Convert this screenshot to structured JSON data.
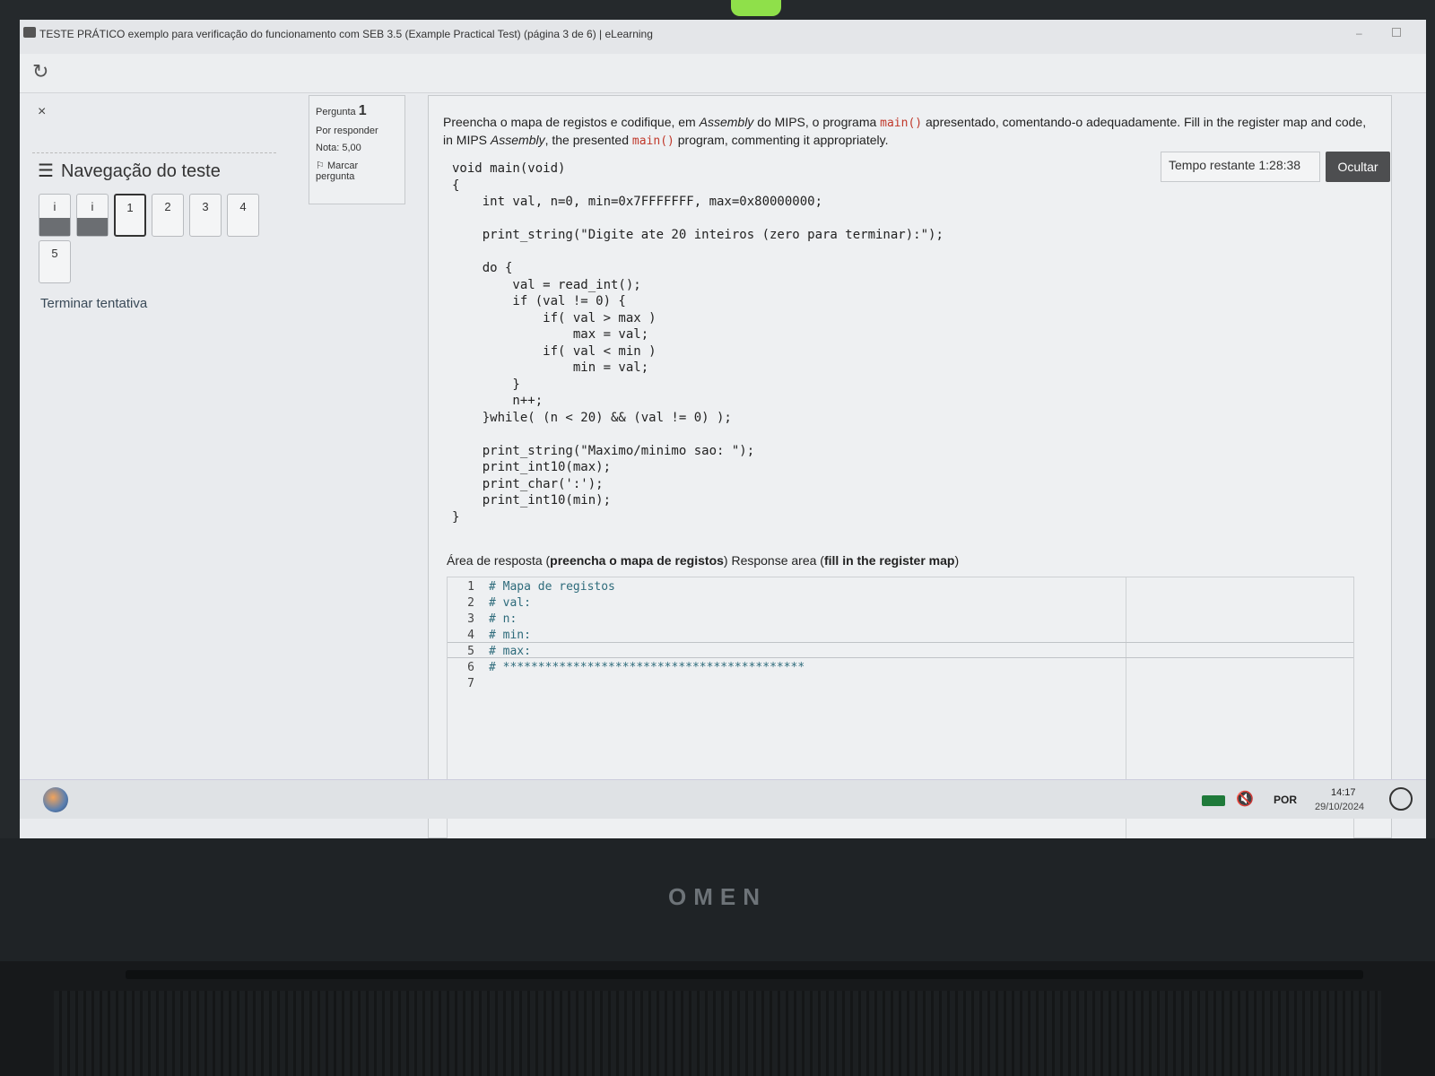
{
  "window": {
    "title": "TESTE PRÁTICO exemplo para verificação do funcionamento com SEB 3.5 (Example Practical Test) (página 3 de 6) | eLearning"
  },
  "nav": {
    "close": "×",
    "title": "Navegação do teste",
    "buttons": [
      "i",
      "i",
      "1",
      "2",
      "3",
      "4",
      "5"
    ],
    "finish": "Terminar tentativa"
  },
  "question": {
    "label": "Pergunta",
    "number": "1",
    "status": "Por responder",
    "grade": "Nota: 5,00",
    "flag": "Marcar pergunta"
  },
  "content": {
    "prompt_a": "Preencha o mapa de registos e codifique, em ",
    "prompt_b": "Assembly",
    "prompt_c": " do MIPS, o programa ",
    "prompt_code": "main()",
    "prompt_d": " apresentado, comentando-o adequadamente. Fill in the register map and code, in MIPS ",
    "prompt_e": "Assembly",
    "prompt_f": ", the presented ",
    "prompt_code2": "main()",
    "prompt_g": " program, commenting it appropriately.",
    "timer": "Tempo restante 1:28:38",
    "hide": "Ocultar",
    "code": [
      "void main(void)",
      "{",
      "    int val, n=0, min=0x7FFFFFFF, max=0x80000000;",
      "",
      "    print_string(\"Digite ate 20 inteiros (zero para terminar):\");",
      "",
      "    do {",
      "        val = read_int();",
      "        if (val != 0) {",
      "            if( val > max )",
      "                max = val;",
      "            if( val < min )",
      "                min = val;",
      "        }",
      "        n++;",
      "    }while( (n < 20) && (val != 0) );",
      "",
      "    print_string(\"Maximo/minimo sao: \");",
      "    print_int10(max);",
      "    print_char(':');",
      "    print_int10(min);",
      "}"
    ],
    "answer_a": "Área de resposta (",
    "answer_b": "preencha o mapa de registos",
    "answer_c": ") Response area (",
    "answer_d": "fill in the register map",
    "answer_e": ")",
    "editor_lines": [
      {
        "n": "1",
        "t": "# Mapa de registos"
      },
      {
        "n": "2",
        "t": "# val:"
      },
      {
        "n": "3",
        "t": "# n:"
      },
      {
        "n": "4",
        "t": "# min:"
      },
      {
        "n": "5",
        "t": "# max:"
      },
      {
        "n": "6",
        "t": "# *******************************************"
      },
      {
        "n": "7",
        "t": ""
      }
    ]
  },
  "taskbar": {
    "lang": "POR",
    "time": "14:17",
    "date": "29/10/2024"
  },
  "device": {
    "brand": "OMEN"
  }
}
